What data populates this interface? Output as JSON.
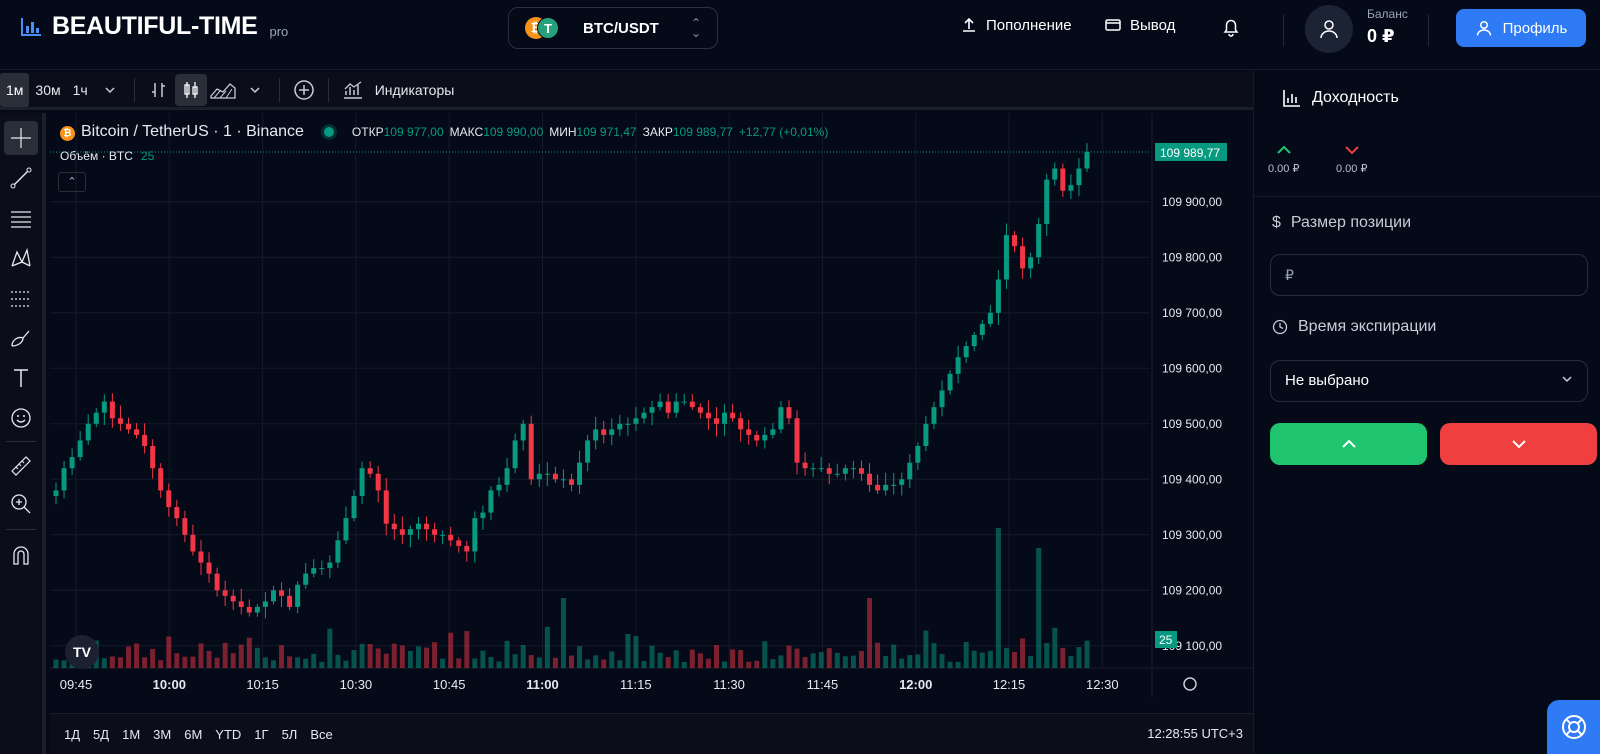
{
  "header": {
    "logo_text": "BEAUTIFUL-TIME",
    "logo_suffix": "pro",
    "pair": "BTC/USDT",
    "deposit": "Пополнение",
    "withdraw": "Вывод",
    "balance_label": "Баланс",
    "balance_value": "0 ₽",
    "profile": "Профиль",
    "accent_color": "#2f7af5"
  },
  "chart_toolbar": {
    "timeframes": [
      "1м",
      "30м",
      "1ч"
    ],
    "active_timeframe": "1м",
    "indicators": "Индикаторы",
    "icons": [
      "chevron-down-icon",
      "bar-chart-icon",
      "candles-icon",
      "area-chart-icon",
      "chevron-down-icon",
      "plus-circle-icon",
      "indicators-icon"
    ]
  },
  "left_tools": [
    "crosshair-icon",
    "trend-line-icon",
    "fib-lines-icon",
    "pattern-icon",
    "forecast-icon",
    "brush-icon",
    "text-icon",
    "emoji-icon",
    "ruler-icon",
    "zoom-icon",
    "magnet-icon"
  ],
  "legend": {
    "symbol": "Bitcoin / TetherUS · 1 · Binance",
    "open_label": "ОТКР",
    "open": "109 977,00",
    "high_label": "МАКС",
    "high": "109 990,00",
    "low_label": "МИН",
    "low": "109 971,47",
    "close_label": "ЗАКР",
    "close": "109 989,77",
    "change": "+12,77 (+0,01%)",
    "volume_label": "Объём · BTC",
    "volume_value": "25"
  },
  "bottom": {
    "ranges": [
      "1Д",
      "5Д",
      "1М",
      "3М",
      "6М",
      "YTD",
      "1Г",
      "5Л",
      "Все"
    ],
    "clock": "12:28:55 UTC+3"
  },
  "right_panel": {
    "yield_title": "Доходность",
    "yield_up": "0.00 ₽",
    "yield_down": "0.00 ₽",
    "position_label": "Размер позиции",
    "position_placeholder": "₽",
    "expiry_label": "Время экспирации",
    "expiry_value": "Не выбрано",
    "up_color": "#1ec46e",
    "down_color": "#ef3f3f"
  },
  "chart_data": {
    "type": "candlestick",
    "up_color": "#089981",
    "down_color": "#f23645",
    "y_ticks": [
      "109 900,00",
      "109 800,00",
      "109 700,00",
      "109 600,00",
      "109 500,00",
      "109 400,00",
      "109 300,00",
      "109 200,00",
      "109 100,00"
    ],
    "y_ticks_values": [
      109900,
      109800,
      109700,
      109600,
      109500,
      109400,
      109300,
      109200,
      109100
    ],
    "x_ticks": [
      "09:45",
      "10:00",
      "10:15",
      "10:30",
      "10:45",
      "11:00",
      "11:15",
      "11:30",
      "11:45",
      "12:00",
      "12:15",
      "12:30"
    ],
    "last_price_label": "109 989,77",
    "last_price": 109989.77,
    "last_volume_label": "25",
    "series_close": [
      109380,
      109420,
      109440,
      109470,
      109500,
      109520,
      109540,
      109510,
      109500,
      109490,
      109480,
      109460,
      109420,
      109380,
      109350,
      109330,
      109300,
      109270,
      109250,
      109230,
      109200,
      109190,
      109180,
      109170,
      109160,
      109170,
      109180,
      109200,
      109190,
      109170,
      109210,
      109230,
      109240,
      109240,
      109250,
      109290,
      109330,
      109370,
      109420,
      109410,
      109380,
      109320,
      109310,
      109300,
      109310,
      109320,
      109310,
      109300,
      109300,
      109290,
      109280,
      109270,
      109330,
      109340,
      109380,
      109390,
      109420,
      109470,
      109500,
      109400,
      109410,
      109410,
      109400,
      109400,
      109390,
      109430,
      109470,
      109490,
      109480,
      109490,
      109500,
      109500,
      109510,
      109520,
      109530,
      109540,
      109520,
      109540,
      109540,
      109530,
      109520,
      109510,
      109500,
      109520,
      109510,
      109490,
      109480,
      109470,
      109480,
      109490,
      109530,
      109510,
      109430,
      109420,
      109420,
      109420,
      109410,
      109410,
      109420,
      109420,
      109410,
      109390,
      109380,
      109390,
      109390,
      109400,
      109430,
      109460,
      109500,
      109530,
      109560,
      109590,
      109620,
      109640,
      109660,
      109680,
      109700,
      109760,
      109840,
      109820,
      109780,
      109800,
      109860,
      109940,
      109960,
      109920,
      109930,
      109960,
      109990
    ],
    "volume_max": 260
  }
}
